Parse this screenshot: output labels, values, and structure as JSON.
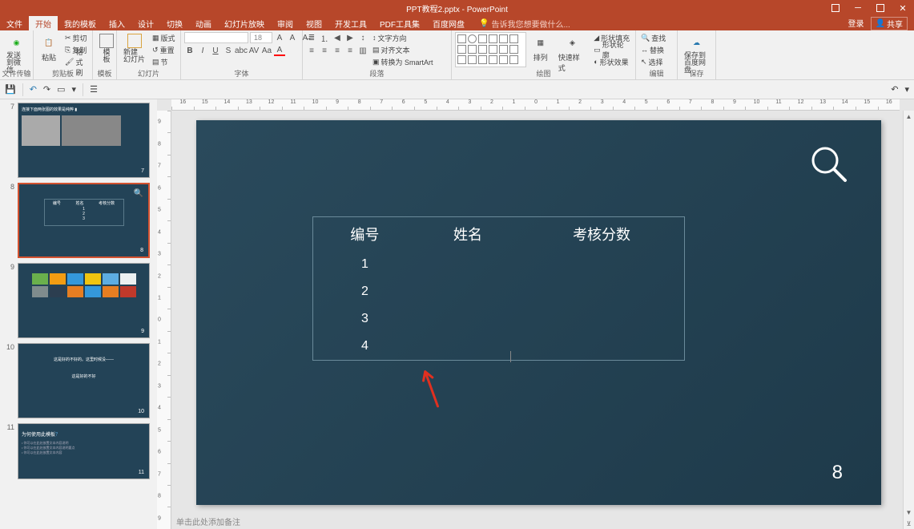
{
  "titlebar": {
    "title": "PPT教程2.pptx - PowerPoint"
  },
  "menubar": {
    "file": "文件",
    "tabs": [
      "开始",
      "我的模板",
      "插入",
      "设计",
      "切换",
      "动画",
      "幻灯片放映",
      "审阅",
      "视图",
      "开发工具",
      "PDF工具集",
      "百度网盘"
    ],
    "active_tab": 0,
    "tell_me": "告诉我您想要做什么...",
    "login": "登录",
    "share": "共享"
  },
  "ribbon": {
    "groups": {
      "file_transfer": {
        "label": "文件传输",
        "send_wechat": "发送\n到微信"
      },
      "clipboard": {
        "label": "剪贴板",
        "paste": "粘贴",
        "cut": "剪切",
        "copy": "复制",
        "format_painter": "格式刷"
      },
      "template": {
        "label": "模板",
        "btn": "模\n板"
      },
      "slides": {
        "label": "幻灯片",
        "new_slide": "新建\n幻灯片",
        "layout": "版式",
        "reset": "重置",
        "section": "节"
      },
      "font": {
        "label": "字体",
        "size": "18"
      },
      "paragraph": {
        "label": "段落",
        "text_direction": "文字方向",
        "align_text": "对齐文本",
        "convert_smartart": "转换为 SmartArt"
      },
      "drawing": {
        "label": "绘图",
        "arrange": "排列",
        "quick_styles": "快速样式",
        "shape_fill": "形状填充",
        "shape_outline": "形状轮廓",
        "shape_effects": "形状效果"
      },
      "editing": {
        "label": "编辑",
        "find": "查找",
        "replace": "替换",
        "select": "选择"
      },
      "save": {
        "label": "保存",
        "save_to": "保存到\n百度网盘"
      }
    }
  },
  "ruler_h": [
    "16",
    "15",
    "14",
    "13",
    "12",
    "11",
    "10",
    "9",
    "8",
    "7",
    "6",
    "5",
    "4",
    "3",
    "2",
    "1",
    "0",
    "1",
    "2",
    "3",
    "4",
    "5",
    "6",
    "7",
    "8",
    "9",
    "10",
    "11",
    "12",
    "13",
    "14",
    "15",
    "16"
  ],
  "ruler_v": [
    "9",
    "8",
    "7",
    "6",
    "5",
    "4",
    "3",
    "2",
    "1",
    "0",
    "1",
    "2",
    "3",
    "4",
    "5",
    "6",
    "7",
    "8",
    "9"
  ],
  "thumbs": [
    {
      "num": "7",
      "page": "7"
    },
    {
      "num": "8",
      "page": "8",
      "selected": true
    },
    {
      "num": "9",
      "page": "9"
    },
    {
      "num": "10",
      "page": "10"
    },
    {
      "num": "11",
      "page": "11"
    }
  ],
  "slide": {
    "table": {
      "headers": [
        "编号",
        "姓名",
        "考核分数"
      ],
      "rows": [
        "1",
        "2",
        "3",
        "4"
      ]
    },
    "page_num": "8"
  },
  "notes_hint": "单击此处添加备注"
}
